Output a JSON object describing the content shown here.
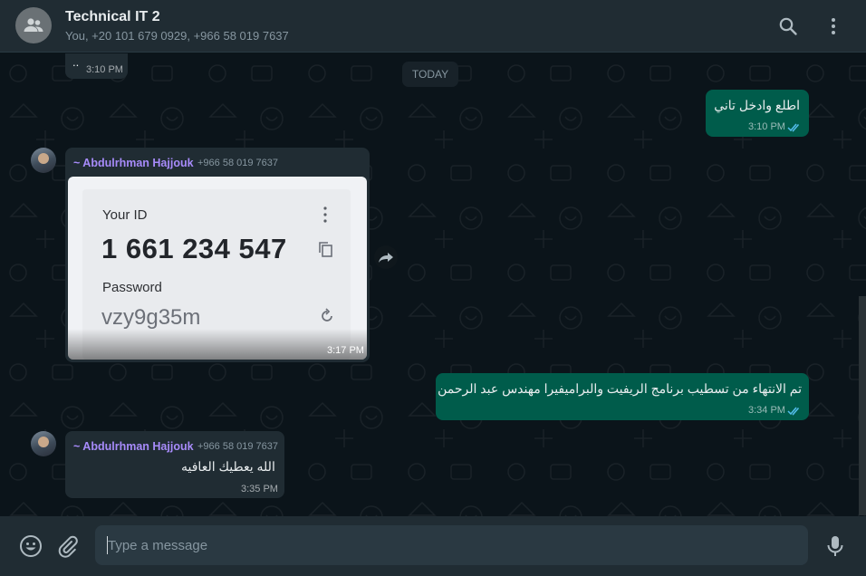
{
  "header": {
    "title": "Technical IT 2",
    "participants": "You, +20 101 679 0929, +966 58 019 7637"
  },
  "date_divider": "TODAY",
  "messages": [
    {
      "direction": "in",
      "text": "..",
      "time": "3:10 PM"
    },
    {
      "direction": "out",
      "text": "اطلع وادخل تاني",
      "time": "3:10 PM",
      "status": "read"
    },
    {
      "direction": "in",
      "sender": "~ Abdulrhman Hajjouk",
      "phone": "+966 58 019 7637",
      "image": {
        "label_id": "Your ID",
        "id_value": "1 661 234 547",
        "label_password": "Password",
        "password_value": "vzy9g35m"
      },
      "time": "3:17 PM"
    },
    {
      "direction": "out",
      "text": "تم الانتهاء من تسطيب برنامج الريفيت والبراميفيرا مهندس عبد الرحمن",
      "time": "3:34 PM",
      "status": "read"
    },
    {
      "direction": "in",
      "sender": "~ Abdulrhman Hajjouk",
      "phone": "+966 58 019 7637",
      "text": "الله يعطيك العافيه",
      "time": "3:35 PM"
    }
  ],
  "composer": {
    "placeholder": "Type a message",
    "value": ""
  },
  "icons": {
    "header": [
      "group-avatar-icon",
      "search-icon",
      "more-vertical-icon"
    ],
    "footer": [
      "emoji-icon",
      "paperclip-icon",
      "microphone-icon"
    ],
    "message": [
      "double-check-icon",
      "forward-icon",
      "copy-icon",
      "refresh-icon"
    ]
  },
  "colors": {
    "header_bg": "#202c33",
    "chat_bg": "#0b141a",
    "incoming_bubble": "#202c33",
    "outgoing_bubble": "#005c4b",
    "sender_name": "#a78bfa",
    "read_ticks": "#53bdeb"
  }
}
